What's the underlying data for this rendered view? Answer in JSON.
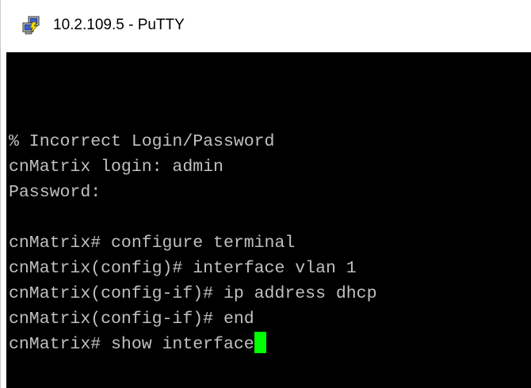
{
  "window": {
    "title": "10.2.109.5 - PuTTY",
    "icon": "putty-computer-icon"
  },
  "terminal": {
    "background": "#000000",
    "text_color": "#c0c0c0",
    "cursor_color": "#00ff00",
    "lines": [
      "% Incorrect Login/Password",
      "cnMatrix login: admin",
      "Password:",
      "",
      "cnMatrix# configure terminal",
      "cnMatrix(config)# interface vlan 1",
      "cnMatrix(config-if)# ip address dhcp",
      "cnMatrix(config-if)# end",
      "cnMatrix# show interface"
    ]
  }
}
